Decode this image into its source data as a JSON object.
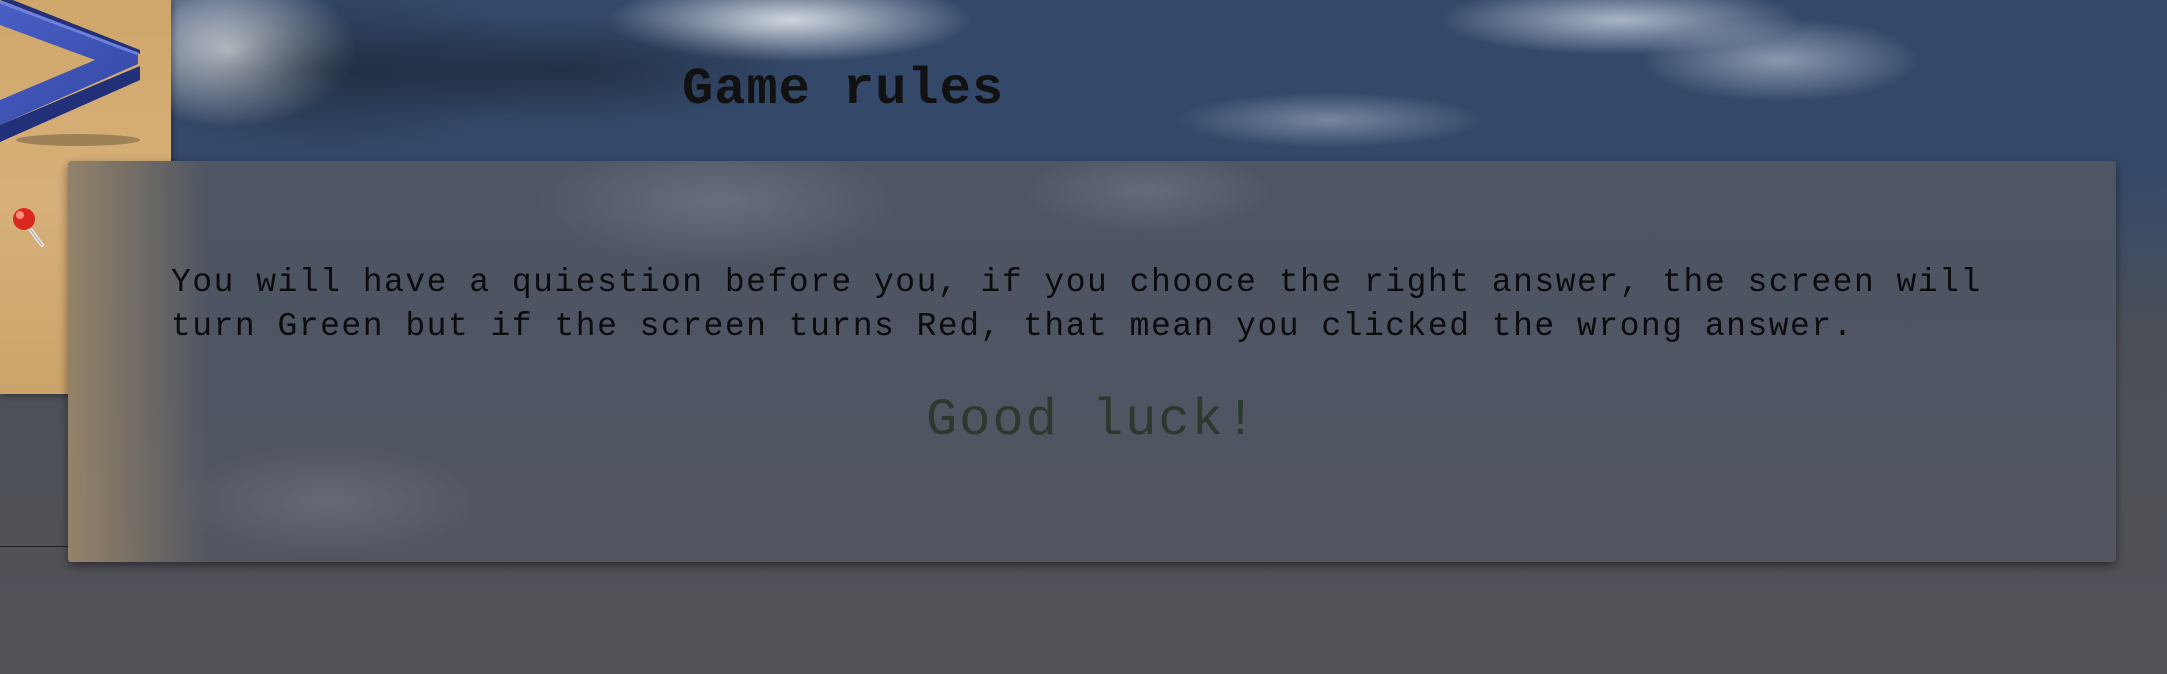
{
  "page": {
    "title": "Game rules",
    "rules_text": "You will have a quiestion before you, if you chooce the right answer, the screen will turn Green but if the screen turns Red, that mean you clicked the wrong answer.",
    "closing": "Good luck!"
  },
  "icons": {
    "nav_arrow": "chevron-right-icon",
    "pin": "push-pin-icon"
  },
  "colors": {
    "arrow": "#3a4fb0",
    "sidebar": "#d4ad74",
    "closing_text": "#2c3a2d"
  }
}
